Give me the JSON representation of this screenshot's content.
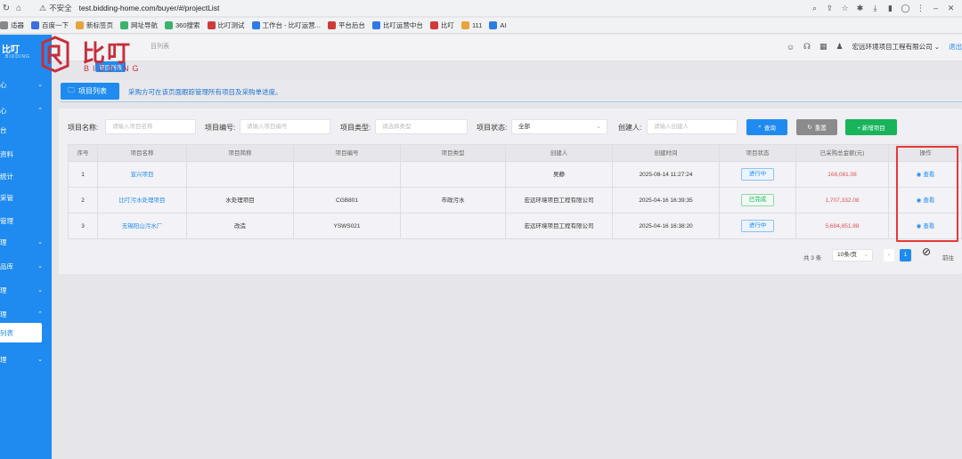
{
  "browser": {
    "insecure_label": "不安全",
    "url": "test.bidding-home.com/buyer/#/projectList",
    "bookmarks": [
      {
        "label": "适器",
        "color": "#888888"
      },
      {
        "label": "百度一下",
        "color": "#3b6fe0"
      },
      {
        "label": "新标签页",
        "color": "#e8a33b"
      },
      {
        "label": "网址导航",
        "color": "#3bb36b"
      },
      {
        "label": "360搜索",
        "color": "#3bb36b"
      },
      {
        "label": "比叮测试",
        "color": "#d13a3a"
      },
      {
        "label": "工作台 - 比叮运营...",
        "color": "#2f7be6"
      },
      {
        "label": "平台后台",
        "color": "#d13a3a"
      },
      {
        "label": "比叮运营中台",
        "color": "#2f7be6"
      },
      {
        "label": "比叮",
        "color": "#d13a3a"
      },
      {
        "label": "111",
        "color": "#e8a33b"
      },
      {
        "label": "AI",
        "color": "#2f7be6"
      }
    ]
  },
  "brand": {
    "name_cn": "比叮",
    "name_en": "BIDDING",
    "side_logo_text": "比叮",
    "side_logo_sub": "BIDDING",
    "color": "#c62f3c"
  },
  "sidebar": {
    "items": [
      {
        "label": "心",
        "chevron": "⌄"
      },
      {
        "label": "心",
        "chevron": "⌃"
      },
      {
        "label": "台",
        "chevron": ""
      },
      {
        "label": "资料",
        "chevron": ""
      },
      {
        "label": "统计",
        "chevron": ""
      },
      {
        "label": "采管",
        "chevron": ""
      },
      {
        "label": "管理",
        "chevron": ""
      },
      {
        "label": "理",
        "chevron": "⌄"
      },
      {
        "label": "品库",
        "chevron": "⌄"
      },
      {
        "label": "理",
        "chevron": "⌄"
      },
      {
        "label": "理",
        "chevron": "⌃"
      },
      {
        "label": "列表",
        "chevron": ""
      },
      {
        "label": "理",
        "chevron": "⌄"
      }
    ],
    "accent": "#1f8bf0"
  },
  "header": {
    "breadcrumb_tail": "目列表",
    "tag": "项目列表",
    "company": "宏远环境项目工程有限公司",
    "company_chevron": "⌄",
    "extra": "退出"
  },
  "title_bar": {
    "tag": "项目列表",
    "description": "采购方可在该页面跟踪管理所有项目及采购单进度。"
  },
  "filters": {
    "name_label": "项目名称:",
    "name_placeholder": "请输入项目名称",
    "code_label": "项目编号:",
    "code_placeholder": "请输入项目编号",
    "type_label": "项目类型:",
    "type_placeholder": "请选择类型",
    "status_label": "项目状态:",
    "status_value": "全部",
    "creator_label": "创建人:",
    "creator_placeholder": "请输入创建人",
    "search_button": "查询",
    "reset_button": "重置",
    "add_button": "+ 新增项目"
  },
  "table": {
    "headers": [
      "序号",
      "项目名称",
      "项目简称",
      "项目编号",
      "项目类型",
      "创建人",
      "创建时间",
      "项目状态",
      "已采购总金额(元)",
      "操作"
    ],
    "rows": [
      {
        "index": "1",
        "name": "宣兴项目",
        "short": "",
        "code": "",
        "type": "",
        "creator": "吴静",
        "created": "2025-08-14 11:27:24",
        "status": "进行中",
        "status_kind": "ongoing",
        "amount": "168,081.08",
        "action": "查看"
      },
      {
        "index": "2",
        "name": "比叮污水处理项目",
        "short": "水处理项目",
        "code": "CGB801",
        "type": "市政污水",
        "creator": "宏远环境项目工程有限公司",
        "created": "2025-04-16 16:39:35",
        "status": "已完成",
        "status_kind": "done",
        "amount": "1,707,332.08",
        "action": "查看"
      },
      {
        "index": "3",
        "name": "无锡阳山污水厂",
        "short": "改造",
        "code": "YSWS021",
        "type": "",
        "creator": "宏远环境项目工程有限公司",
        "created": "2025-04-16 16:38:20",
        "status": "进行中",
        "status_kind": "ongoing",
        "amount": "5,684,851.88",
        "action": "查看"
      }
    ]
  },
  "pagination": {
    "total": "共 3 条",
    "page_size": "10条/页",
    "current_page": "1",
    "goto": "前往"
  },
  "colors": {
    "primary": "#1f8bf0",
    "success": "#19b35a",
    "danger_amount": "#e05252",
    "highlight": "#e53935"
  }
}
